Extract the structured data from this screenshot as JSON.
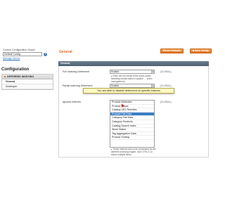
{
  "scope": {
    "label": "Current Configuration Scope:",
    "value": "Default Config",
    "link": "Manage Stores"
  },
  "config_nav": {
    "title": "Configuration",
    "section": "DEFERRED INDEXING",
    "items": [
      {
        "label": "General",
        "active": true
      },
      {
        "label": "Developer",
        "active": false
      }
    ]
  },
  "main": {
    "title": "General",
    "buttons": {
      "revert": "Revert Defaults",
      "save": "Save Config"
    },
    "group_title": "General",
    "fields": {
      "full": {
        "label": "Full Indexing Deferment",
        "value": "Enable",
        "scope": "[GLOBAL]",
        "hint": "Enter the full rebuilt of the index (when selecting rebuild index in system → index management)"
      },
      "partial": {
        "label": "Partial Indexing Deferment",
        "value": "Enable",
        "scope": "[GLOBAL]"
      },
      "ignored": {
        "label": "Ignored Indexes",
        "scope": "[GLOBAL]",
        "options": [
          "Product Attributes",
          "Product Prices",
          "Catalog URL Rewrites",
          "Product Flat Data",
          "Category Flat Data",
          "Category Products",
          "Catalog Search Index",
          "Stock Status",
          "Tag Aggregation Data",
          "Product Sorting"
        ],
        "selected": "Product Flat Data",
        "hint": "These indexes will not be processed by the deferred indexing engine. Use CTRL-C to select multiple items."
      }
    }
  },
  "tooltip": "You are able to disable deferment on specific indexes",
  "colors": {
    "accent": "#e86a1c",
    "group_bar": "#5b6f7f",
    "selection": "#3a7ec6",
    "tooltip_bg": "#fff9c2"
  }
}
